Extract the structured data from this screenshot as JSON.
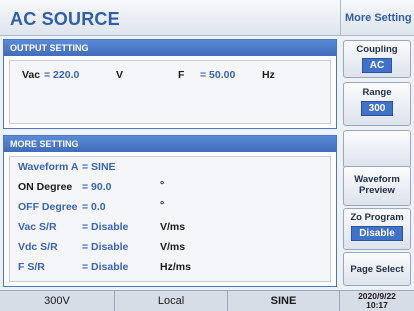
{
  "header": {
    "title": "AC SOURCE",
    "side_title": "More Setting"
  },
  "output_setting": {
    "title": "OUTPUT SETTING",
    "vac_label": "Vac",
    "vac_value": "= 220.0",
    "vac_unit": "V",
    "f_label": "F",
    "f_value": "= 50.00",
    "f_unit": "Hz"
  },
  "more_setting": {
    "title": "MORE SETTING",
    "rows": [
      {
        "label": "Waveform A",
        "value": "= SINE",
        "unit": ""
      },
      {
        "label": "ON Degree",
        "value": "= 90.0",
        "unit": "°"
      },
      {
        "label": "OFF  Degree",
        "value": "= 0.0",
        "unit": "°"
      },
      {
        "label": "Vac S/R",
        "value": "= Disable",
        "unit": "V/ms"
      },
      {
        "label": "Vdc S/R",
        "value": "= Disable",
        "unit": "V/ms"
      },
      {
        "label": "F S/R",
        "value": "= Disable",
        "unit": "Hz/ms"
      }
    ]
  },
  "softkeys": {
    "coupling": {
      "label": "Coupling",
      "value": "AC"
    },
    "range": {
      "label": "Range",
      "value": "300"
    },
    "waveform_preview": {
      "line1": "Waveform",
      "line2": "Preview"
    },
    "zo_program": {
      "label": "Zo Program",
      "value": "Disable"
    },
    "page_select": {
      "label": "Page Select"
    }
  },
  "status_bar": {
    "range": "300V",
    "mode": "Local",
    "waveform": "SINE",
    "date": "2020/9/22",
    "time": "10:17"
  },
  "colors": {
    "accent": "#3f72c8",
    "panel_head": "#4a7bcb",
    "label_blue": "#3a64b4"
  }
}
